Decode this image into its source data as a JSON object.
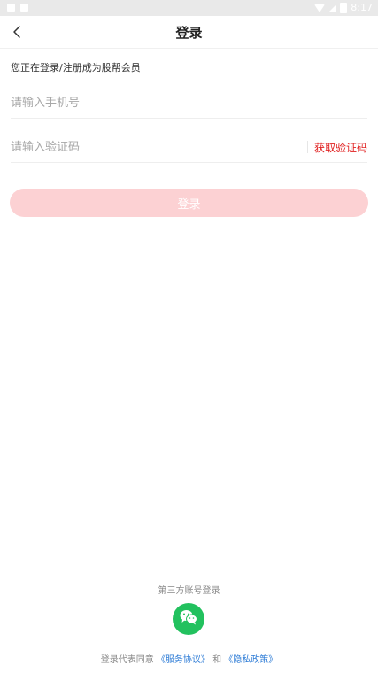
{
  "status_bar": {
    "time": "8:17"
  },
  "header": {
    "title": "登录",
    "back_icon": "chevron-left-icon"
  },
  "form": {
    "subtitle": "您正在登录/注册成为股帮会员",
    "phone_placeholder": "请输入手机号",
    "code_placeholder": "请输入验证码",
    "get_code_label": "获取验证码",
    "login_label": "登录"
  },
  "footer": {
    "third_party_label": "第三方账号登录",
    "wechat_icon": "wechat-icon",
    "agreement_prefix": "登录代表同意",
    "service_agreement": "《服务协议》",
    "conjunction": "和",
    "privacy_policy": "《隐私政策》"
  },
  "colors": {
    "accent": "#e02020",
    "button_disabled": "#fcd1d3",
    "wechat": "#22c15e",
    "link": "#2e7cd6"
  }
}
